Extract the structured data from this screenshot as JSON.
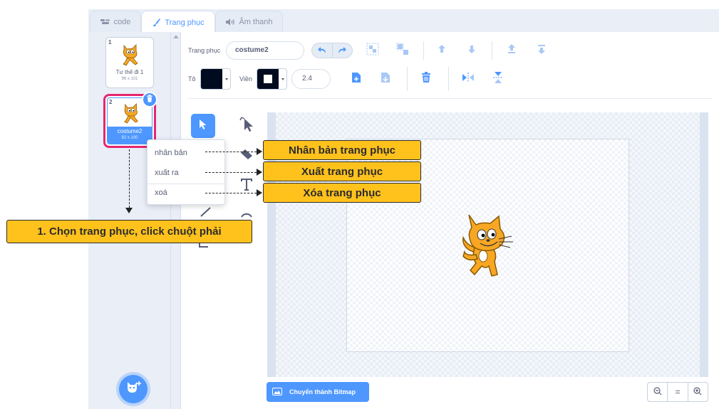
{
  "tabs": [
    {
      "label": "code",
      "icon": "code-icon"
    },
    {
      "label": "Trang phục",
      "icon": "brush-icon"
    },
    {
      "label": "Âm thanh",
      "icon": "speaker-icon"
    }
  ],
  "costumes": [
    {
      "number": "1",
      "name": "Tư thế đi 1",
      "size": "96 x 101"
    },
    {
      "number": "2",
      "name": "costume2",
      "size": "92 x 100"
    }
  ],
  "toolbar": {
    "costume_label": "Trang phục",
    "costume_name": "costume2",
    "fill_label": "Tô",
    "outline_label": "Viền",
    "stroke_width": "2.4",
    "fill_color": "#000b1f",
    "outline_color": "#000b1f"
  },
  "context_menu": {
    "duplicate": "nhân bản",
    "export": "xuất ra",
    "delete": "xoá"
  },
  "bottom": {
    "bitmap_button": "Chuyển thành Bitmap",
    "zoom_reset": "="
  },
  "annotations": {
    "step1": "1. Chọn trang phục, click chuột phải",
    "duplicate": "Nhân bản trang phục",
    "export": "Xuất trang phục",
    "delete": "Xóa trang phục"
  },
  "colors": {
    "accent": "#4d97ff",
    "highlight": "#e8266d",
    "callout": "#ffc21c"
  }
}
